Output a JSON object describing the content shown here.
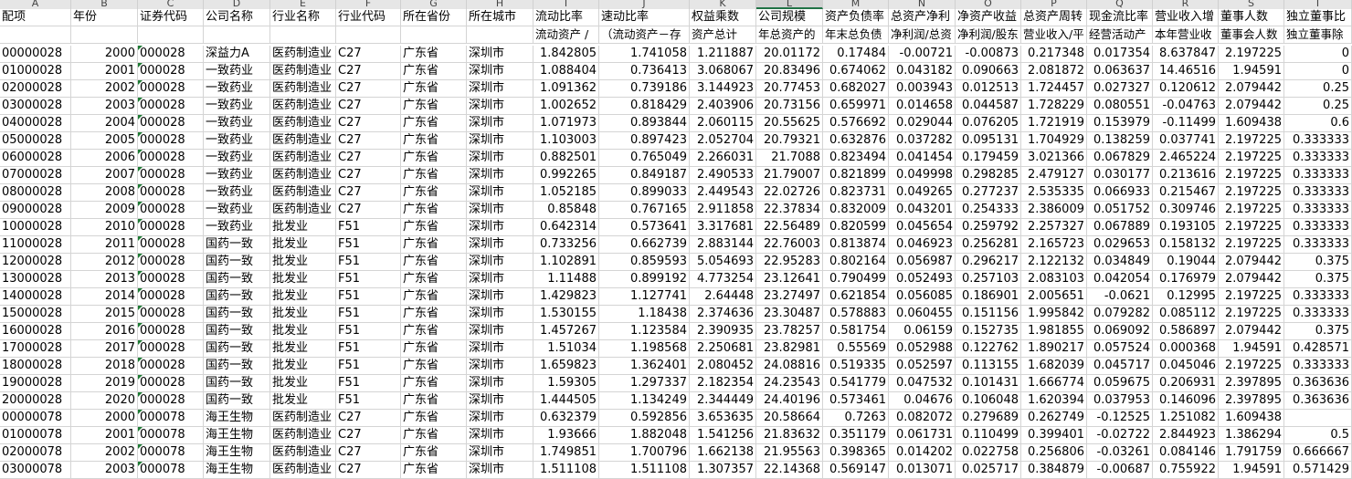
{
  "columns": [
    "A",
    "B",
    "C",
    "D",
    "E",
    "F",
    "G",
    "H",
    "I",
    "J",
    "K",
    "L",
    "M",
    "N",
    "O",
    "P",
    "Q",
    "R",
    "S",
    "T"
  ],
  "selected_column": "L",
  "header_row1": [
    "配项",
    "年份",
    "证券代码",
    "公司名称",
    "行业名称",
    "行业代码",
    "所在省份",
    "所在城市",
    "流动比率",
    "速动比率",
    "权益乘数",
    "公司规模",
    "资产负债率",
    "总资产净利",
    "净资产收益",
    "总资产周转",
    "现金流比率",
    "营业收入增",
    "董事人数",
    "独立董事比"
  ],
  "header_row2": [
    "",
    "",
    "",
    "",
    "",
    "",
    "",
    "",
    "流动资产 / ",
    "（流动资产－存",
    "资产总计",
    "年总资产的",
    "年末总负债",
    "净利润/总资",
    "净利润/股东",
    "营业收入/平",
    "经营活动产",
    "本年营业收",
    "董事会人数",
    "独立董事除"
  ],
  "rows": [
    [
      "00000028",
      "2000",
      "000028",
      "深益力A",
      "医药制造业",
      "C27",
      "广东省",
      "深圳市",
      "1.842805",
      "1.741058",
      "1.211887",
      "20.01172",
      "0.17484",
      "-0.00721",
      "-0.00873",
      "0.217348",
      "0.017354",
      "8.637847",
      "2.197225",
      "0"
    ],
    [
      "01000028",
      "2001",
      "000028",
      "一致药业",
      "医药制造业",
      "C27",
      "广东省",
      "深圳市",
      "1.088404",
      "0.736413",
      "3.068067",
      "20.83496",
      "0.674062",
      "0.043182",
      "0.090663",
      "2.081872",
      "0.063637",
      "14.46516",
      "1.94591",
      "0"
    ],
    [
      "02000028",
      "2002",
      "000028",
      "一致药业",
      "医药制造业",
      "C27",
      "广东省",
      "深圳市",
      "1.091362",
      "0.739186",
      "3.144923",
      "20.77453",
      "0.682027",
      "0.003943",
      "0.012513",
      "1.724457",
      "0.027327",
      "0.120612",
      "2.079442",
      "0.25"
    ],
    [
      "03000028",
      "2003",
      "000028",
      "一致药业",
      "医药制造业",
      "C27",
      "广东省",
      "深圳市",
      "1.002652",
      "0.818429",
      "2.403906",
      "20.73156",
      "0.659971",
      "0.014658",
      "0.044587",
      "1.728229",
      "0.080551",
      "-0.04763",
      "2.079442",
      "0.25"
    ],
    [
      "04000028",
      "2004",
      "000028",
      "一致药业",
      "医药制造业",
      "C27",
      "广东省",
      "深圳市",
      "1.071973",
      "0.893844",
      "2.060115",
      "20.55625",
      "0.576692",
      "0.029044",
      "0.076205",
      "1.721919",
      "0.153979",
      "-0.11499",
      "1.609438",
      "0.6"
    ],
    [
      "05000028",
      "2005",
      "000028",
      "一致药业",
      "医药制造业",
      "C27",
      "广东省",
      "深圳市",
      "1.103003",
      "0.897423",
      "2.052704",
      "20.79321",
      "0.632876",
      "0.037282",
      "0.095131",
      "1.704929",
      "0.138259",
      "0.037741",
      "2.197225",
      "0.333333"
    ],
    [
      "06000028",
      "2006",
      "000028",
      "一致药业",
      "医药制造业",
      "C27",
      "广东省",
      "深圳市",
      "0.882501",
      "0.765049",
      "2.266031",
      "21.7088",
      "0.823494",
      "0.041454",
      "0.179459",
      "3.021366",
      "0.067829",
      "2.465224",
      "2.197225",
      "0.333333"
    ],
    [
      "07000028",
      "2007",
      "000028",
      "一致药业",
      "医药制造业",
      "C27",
      "广东省",
      "深圳市",
      "0.992265",
      "0.849187",
      "2.490533",
      "21.79007",
      "0.821899",
      "0.049998",
      "0.298285",
      "2.479127",
      "0.030177",
      "0.213616",
      "2.197225",
      "0.333333"
    ],
    [
      "08000028",
      "2008",
      "000028",
      "一致药业",
      "医药制造业",
      "C27",
      "广东省",
      "深圳市",
      "1.052185",
      "0.899033",
      "2.449543",
      "22.02726",
      "0.823731",
      "0.049265",
      "0.277237",
      "2.535335",
      "0.066933",
      "0.215467",
      "2.197225",
      "0.333333"
    ],
    [
      "09000028",
      "2009",
      "000028",
      "一致药业",
      "医药制造业",
      "C27",
      "广东省",
      "深圳市",
      "0.85848",
      "0.767165",
      "2.911858",
      "22.37834",
      "0.832009",
      "0.043201",
      "0.254333",
      "2.386009",
      "0.051752",
      "0.309746",
      "2.197225",
      "0.333333"
    ],
    [
      "10000028",
      "2010",
      "000028",
      "一致药业",
      "批发业",
      "F51",
      "广东省",
      "深圳市",
      "0.642314",
      "0.573641",
      "3.317681",
      "22.56489",
      "0.820599",
      "0.045654",
      "0.259792",
      "2.257327",
      "0.067889",
      "0.193105",
      "2.197225",
      "0.333333"
    ],
    [
      "11000028",
      "2011",
      "000028",
      "国药一致",
      "批发业",
      "F51",
      "广东省",
      "深圳市",
      "0.733256",
      "0.662739",
      "2.883144",
      "22.76003",
      "0.813874",
      "0.046923",
      "0.256281",
      "2.165723",
      "0.029653",
      "0.158132",
      "2.197225",
      "0.333333"
    ],
    [
      "12000028",
      "2012",
      "000028",
      "国药一致",
      "批发业",
      "F51",
      "广东省",
      "深圳市",
      "1.102891",
      "0.859593",
      "5.054693",
      "22.95283",
      "0.802164",
      "0.056987",
      "0.296217",
      "2.122132",
      "0.034849",
      "0.19044",
      "2.079442",
      "0.375"
    ],
    [
      "13000028",
      "2013",
      "000028",
      "国药一致",
      "批发业",
      "F51",
      "广东省",
      "深圳市",
      "1.11488",
      "0.899192",
      "4.773254",
      "23.12641",
      "0.790499",
      "0.052493",
      "0.257103",
      "2.083103",
      "0.042054",
      "0.176979",
      "2.079442",
      "0.375"
    ],
    [
      "14000028",
      "2014",
      "000028",
      "国药一致",
      "批发业",
      "F51",
      "广东省",
      "深圳市",
      "1.429823",
      "1.127741",
      "2.64448",
      "23.27497",
      "0.621854",
      "0.056085",
      "0.186901",
      "2.005651",
      "-0.0621",
      "0.12995",
      "2.197225",
      "0.333333"
    ],
    [
      "15000028",
      "2015",
      "000028",
      "国药一致",
      "批发业",
      "F51",
      "广东省",
      "深圳市",
      "1.530155",
      "1.18438",
      "2.374636",
      "23.30487",
      "0.578883",
      "0.060455",
      "0.151156",
      "1.995842",
      "0.079282",
      "0.085112",
      "2.197225",
      "0.333333"
    ],
    [
      "16000028",
      "2016",
      "000028",
      "国药一致",
      "批发业",
      "F51",
      "广东省",
      "深圳市",
      "1.457267",
      "1.123584",
      "2.390935",
      "23.78257",
      "0.581754",
      "0.06159",
      "0.152735",
      "1.981855",
      "0.069092",
      "0.586897",
      "2.079442",
      "0.375"
    ],
    [
      "17000028",
      "2017",
      "000028",
      "国药一致",
      "批发业",
      "F51",
      "广东省",
      "深圳市",
      "1.51034",
      "1.198568",
      "2.250681",
      "23.82981",
      "0.55569",
      "0.052988",
      "0.122762",
      "1.890217",
      "0.057524",
      "0.000368",
      "1.94591",
      "0.428571"
    ],
    [
      "18000028",
      "2018",
      "000028",
      "国药一致",
      "批发业",
      "F51",
      "广东省",
      "深圳市",
      "1.659823",
      "1.362401",
      "2.080452",
      "24.08816",
      "0.519335",
      "0.052597",
      "0.113155",
      "1.682039",
      "0.045717",
      "0.045046",
      "2.197225",
      "0.333333"
    ],
    [
      "19000028",
      "2019",
      "000028",
      "国药一致",
      "批发业",
      "F51",
      "广东省",
      "深圳市",
      "1.59305",
      "1.297337",
      "2.182354",
      "24.23543",
      "0.541779",
      "0.047532",
      "0.101431",
      "1.666774",
      "0.059675",
      "0.206931",
      "2.397895",
      "0.363636"
    ],
    [
      "20000028",
      "2020",
      "000028",
      "国药一致",
      "批发业",
      "F51",
      "广东省",
      "深圳市",
      "1.444505",
      "1.134249",
      "2.344449",
      "24.40196",
      "0.573461",
      "0.04676",
      "0.106048",
      "1.620394",
      "0.037953",
      "0.146096",
      "2.397895",
      "0.363636"
    ],
    [
      "00000078",
      "2000",
      "000078",
      "海王生物",
      "医药制造业",
      "C27",
      "广东省",
      "深圳市",
      "0.632379",
      "0.592856",
      "3.653635",
      "20.58664",
      "0.7263",
      "0.082072",
      "0.279689",
      "0.262749",
      "-0.12525",
      "1.251082",
      "1.609438",
      ""
    ],
    [
      "01000078",
      "2001",
      "000078",
      "海王生物",
      "医药制造业",
      "C27",
      "广东省",
      "深圳市",
      "1.93666",
      "1.882048",
      "1.541256",
      "21.83632",
      "0.351179",
      "0.061731",
      "0.110499",
      "0.399401",
      "-0.02722",
      "2.844923",
      "1.386294",
      "0.5"
    ],
    [
      "02000078",
      "2002",
      "000078",
      "海王生物",
      "医药制造业",
      "C27",
      "广东省",
      "深圳市",
      "1.749851",
      "1.700796",
      "1.662138",
      "21.95563",
      "0.398365",
      "0.014202",
      "0.022758",
      "0.256806",
      "-0.03261",
      "0.084146",
      "1.791759",
      "0.666667"
    ],
    [
      "03000078",
      "2003",
      "000078",
      "海王生物",
      "医药制造业",
      "C27",
      "广东省",
      "深圳市",
      "1.511108",
      "1.511108",
      "1.307357",
      "22.14368",
      "0.569147",
      "0.013071",
      "0.025717",
      "0.384879",
      "-0.00687",
      "0.755922",
      "1.94591",
      "0.571429"
    ]
  ]
}
